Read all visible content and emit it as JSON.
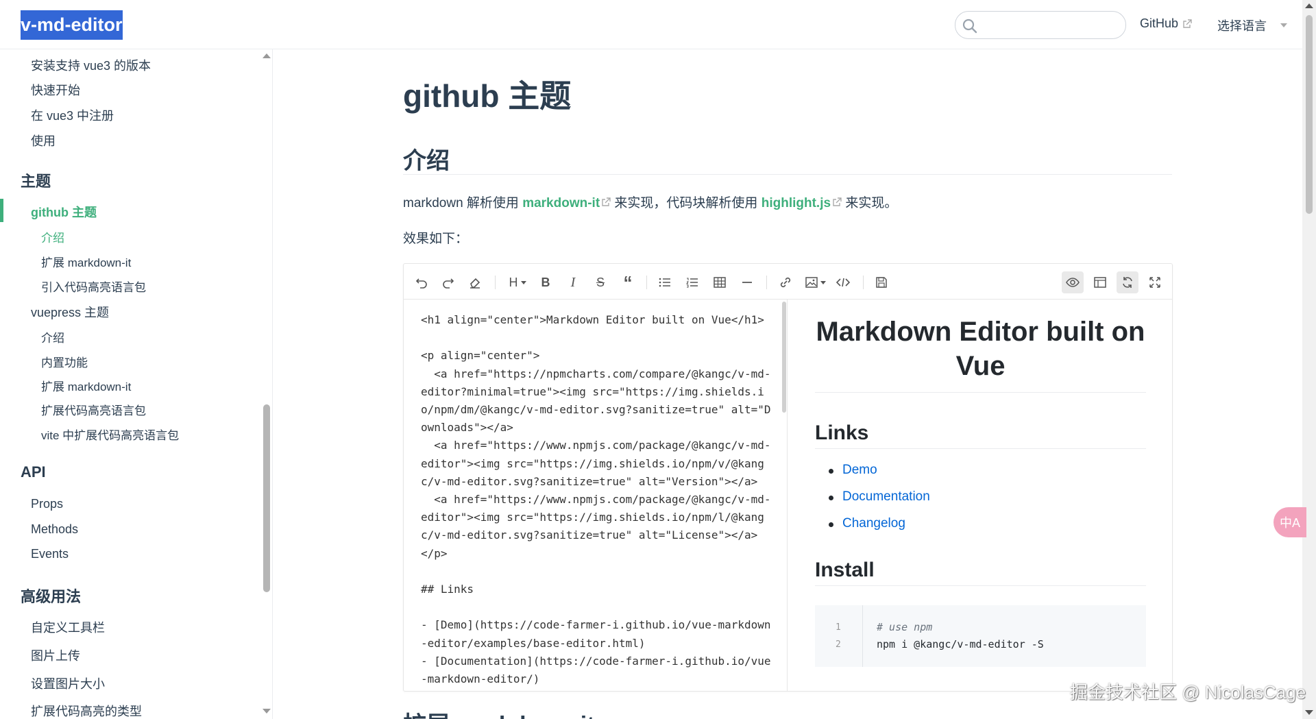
{
  "navbar": {
    "site_name": "v-md-editor",
    "search_placeholder": "",
    "github_label": "GitHub",
    "language_label": "选择语言"
  },
  "sidebar": {
    "items": [
      {
        "label": "安装支持 vue3 的版本"
      },
      {
        "label": "快速开始"
      },
      {
        "label": "在 vue3 中注册"
      },
      {
        "label": "使用"
      }
    ],
    "theme_heading": "主题",
    "github_theme": "github 主题",
    "github_sub": [
      "介绍",
      "扩展 markdown-it",
      "引入代码高亮语言包"
    ],
    "vuepress_theme": "vuepress 主题",
    "vuepress_sub": [
      "介绍",
      "内置功能",
      "扩展 markdown-it",
      "扩展代码高亮语言包",
      "vite 中扩展代码高亮语言包"
    ],
    "api_heading": "API",
    "api_items": [
      "Props",
      "Methods",
      "Events"
    ],
    "advanced_heading": "高级用法",
    "advanced_items": [
      "自定义工具栏",
      "图片上传",
      "设置图片大小",
      "扩展代码高亮的类型"
    ]
  },
  "content": {
    "title": "github 主题",
    "intro_heading": "介绍",
    "intro_p1_a": "markdown 解析使用 ",
    "intro_link1": "markdown-it",
    "intro_p1_b": " 来实现，代码块解析使用 ",
    "intro_link2": "highlight.js",
    "intro_p1_c": " 来实现。",
    "intro_p2": "效果如下：",
    "next_heading": "扩展 markdown-it"
  },
  "editor": {
    "code_lines": [
      "<h1 align=\"center\">Markdown Editor built on Vue</h1>",
      "",
      "<p align=\"center\">",
      "  <a href=\"https://npmcharts.com/compare/@kangc/v-md-",
      "editor?minimal=true\"><img src=\"https://img.shields.i",
      "o/npm/dm/@kangc/v-md-editor.svg?sanitize=true\" alt=\"D",
      "ownloads\"></a>",
      "  <a href=\"https://www.npmjs.com/package/@kangc/v-md-",
      "editor\"><img src=\"https://img.shields.io/npm/v/@kang",
      "c/v-md-editor.svg?sanitize=true\" alt=\"Version\"></a>",
      "  <a href=\"https://www.npmjs.com/package/@kangc/v-md-",
      "editor\"><img src=\"https://img.shields.io/npm/l/@kang",
      "c/v-md-editor.svg?sanitize=true\" alt=\"License\"></a>",
      "</p>",
      "",
      "## Links",
      "",
      "- [Demo](https://code-farmer-i.github.io/vue-markdown",
      "-editor/examples/base-editor.html)",
      "- [Documentation](https://code-farmer-i.github.io/vue",
      "-markdown-editor/)"
    ],
    "preview": {
      "title": "Markdown Editor built on Vue",
      "links_heading": "Links",
      "links": [
        "Demo",
        "Documentation",
        "Changelog"
      ],
      "install_heading": "Install",
      "code_numbers": [
        "1",
        "2"
      ],
      "code_comment": "# use npm",
      "code_cmd": "npm i @kangc/v-md-editor -S"
    }
  },
  "float_button": "中A",
  "watermark": "掘金技术社区 @ NicolasCage"
}
